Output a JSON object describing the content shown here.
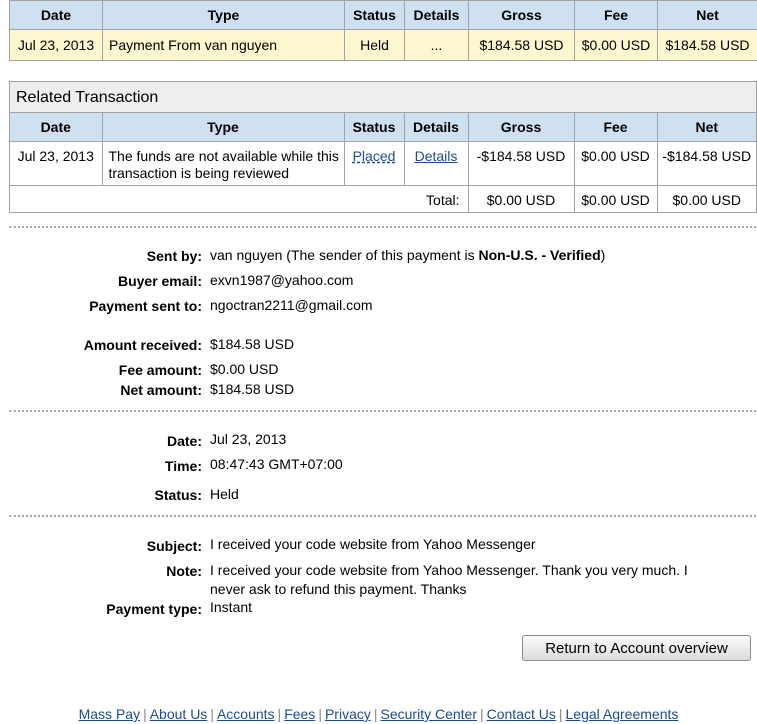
{
  "columns": [
    "Date",
    "Type",
    "Status",
    "Details",
    "Gross",
    "Fee",
    "Net"
  ],
  "transaction": {
    "date": "Jul 23, 2013",
    "type": "Payment From van nguyen",
    "status": "Held",
    "details": "...",
    "gross": "$184.58 USD",
    "fee": "$0.00 USD",
    "net": "$184.58 USD"
  },
  "related": {
    "title": "Related Transaction",
    "row": {
      "date": "Jul 23, 2013",
      "type": "The funds are not available while this transaction is being reviewed",
      "status": "Placed",
      "details": "Details",
      "gross": "-$184.58 USD",
      "fee": "$0.00 USD",
      "net": "-$184.58 USD"
    },
    "total_label": "Total:",
    "total_gross": "$0.00 USD",
    "total_fee": "$0.00 USD",
    "total_net": "$0.00 USD"
  },
  "info": {
    "sent_by_label": "Sent by:",
    "sent_by_name": "van nguyen",
    "sent_by_pre": "(The sender of this payment is ",
    "sent_by_status": "Non-U.S. - Verified",
    "sent_by_post": ")",
    "buyer_email_label": "Buyer email:",
    "buyer_email": "exvn1987@yahoo.com",
    "payment_sent_to_label": "Payment sent to:",
    "payment_sent_to": "ngoctran2211@gmail.com",
    "amount_received_label": "Amount received:",
    "amount_received": "$184.58 USD",
    "fee_amount_label": "Fee amount:",
    "fee_amount": "$0.00 USD",
    "net_amount_label": "Net amount:",
    "net_amount": "$184.58 USD",
    "date_label": "Date:",
    "date": "Jul 23, 2013",
    "time_label": "Time:",
    "time": "08:47:43 GMT+07:00",
    "status_label": "Status:",
    "status": "Held",
    "subject_label": "Subject:",
    "subject": "I received your code website from Yahoo Messenger",
    "note_label": "Note:",
    "note": "I received your code website from Yahoo Messenger. Thank you very much. I never ask to refund this payment. Thanks",
    "payment_type_label": "Payment type:",
    "payment_type": "Instant"
  },
  "return_button": "Return to Account overview",
  "footer_links": [
    "Mass Pay",
    "About Us",
    "Accounts",
    "Fees",
    "Privacy",
    "Security Center",
    "Contact Us",
    "Legal Agreements"
  ],
  "colors": {
    "header_bg": "#cfe0f0",
    "highlight_row": "#fcf7cf",
    "link": "#1c4c92"
  }
}
